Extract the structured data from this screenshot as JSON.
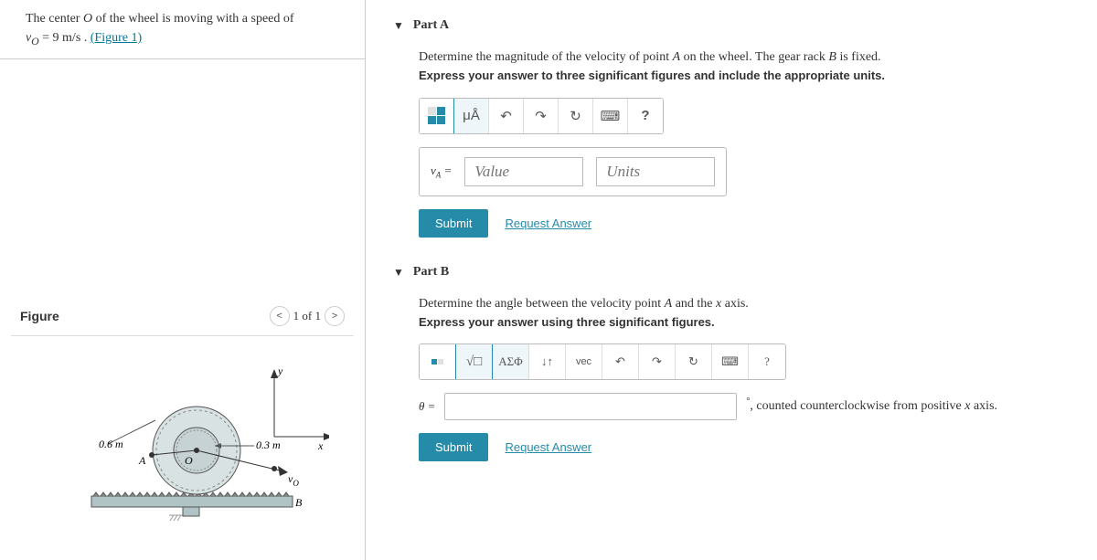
{
  "problem": {
    "line1_prefix": "The center ",
    "line1_var_O": "O",
    "line1_mid": " of the wheel is moving with a speed of ",
    "line2_varv": "v",
    "line2_subO": "O",
    "line2_eq": " = 9 m/s .",
    "figure_link": "(Figure 1)"
  },
  "figure": {
    "title": "Figure",
    "nav_label": "1 of 1",
    "dim_outer": "0.6 m",
    "dim_inner": "0.3 m",
    "label_A": "A",
    "label_B": "B",
    "label_O": "O",
    "label_v": "v",
    "axis_x": "x",
    "axis_y": "y"
  },
  "partA": {
    "title": "Part A",
    "instr": "Determine the magnitude of the velocity of point ",
    "instr_varA": "A",
    "instr_mid": " on the wheel. The gear rack ",
    "instr_varB": "B",
    "instr_end": " is fixed.",
    "instr2": "Express your answer to three significant figures and include the appropriate units.",
    "var": "v",
    "sub": "A",
    "eq": "=",
    "value_ph": "Value",
    "units_ph": "Units",
    "mu": "μÅ",
    "submit": "Submit",
    "request": "Request Answer",
    "help": "?"
  },
  "partB": {
    "title": "Part B",
    "instr": "Determine the angle between the velocity point ",
    "instr_varA": "A",
    "instr_end": " and the ",
    "instr_varx": "x",
    "instr_end2": " axis.",
    "instr2": "Express your answer using three significant figures.",
    "greek": "ΑΣΦ",
    "updown": "↓↑",
    "vec": "vec",
    "help": "?",
    "var": "θ",
    "eq": " =",
    "suffix_deg": "°",
    "suffix_text": ", counted counterclockwise from positive ",
    "suffix_varx": "x",
    "suffix_end": " axis.",
    "submit": "Submit",
    "request": "Request Answer"
  }
}
